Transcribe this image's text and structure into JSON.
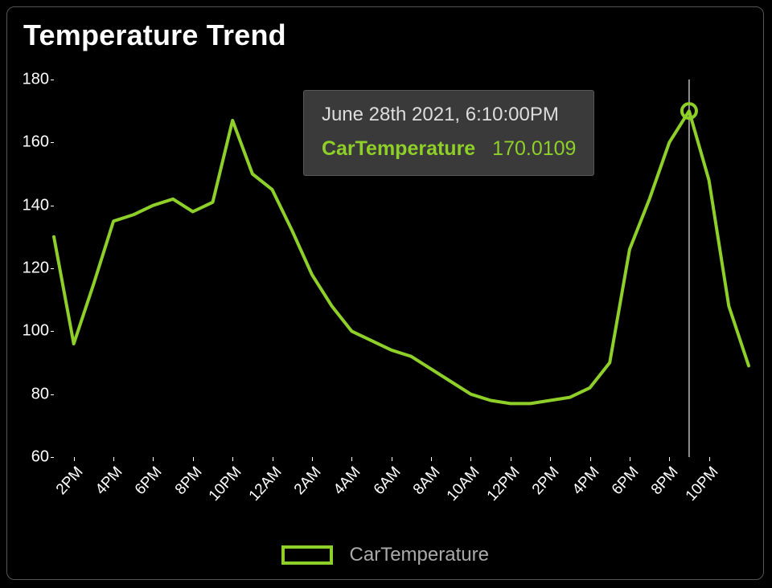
{
  "title": "Temperature Trend",
  "legend": {
    "series_name": "CarTemperature"
  },
  "tooltip": {
    "timestamp": "June 28th 2021, 6:10:00PM",
    "series": "CarTemperature",
    "value": "170.0109"
  },
  "chart_data": {
    "type": "line",
    "title": "Temperature Trend",
    "xlabel": "",
    "ylabel": "",
    "ylim": [
      60,
      180
    ],
    "y_ticks": [
      60,
      80,
      100,
      120,
      140,
      160,
      180
    ],
    "x_tick_labels": [
      "2PM",
      "4PM",
      "6PM",
      "8PM",
      "10PM",
      "12AM",
      "2AM",
      "4AM",
      "6AM",
      "8AM",
      "10AM",
      "12PM",
      "2PM",
      "4PM",
      "6PM",
      "8PM",
      "10PM"
    ],
    "series": [
      {
        "name": "CarTemperature",
        "color": "#8ecf29",
        "x": [
          0,
          1,
          2,
          3,
          4,
          5,
          6,
          7,
          8,
          9,
          10,
          11,
          12,
          13,
          14,
          15,
          16,
          17,
          18,
          19,
          20,
          21,
          22,
          23,
          24,
          25,
          26,
          27,
          28,
          29,
          30,
          31,
          32,
          33,
          34,
          35
        ],
        "y": [
          130,
          96,
          115,
          135,
          137,
          140,
          142,
          138,
          141,
          167,
          150,
          145,
          132,
          118,
          108,
          100,
          97,
          94,
          92,
          88,
          84,
          80,
          78,
          77,
          77,
          78,
          79,
          82,
          90,
          126,
          142,
          160,
          170,
          148,
          108,
          89
        ]
      }
    ],
    "hover_point": {
      "x_index": 32,
      "y": 170.0109
    },
    "x_domain": [
      0,
      35
    ]
  }
}
